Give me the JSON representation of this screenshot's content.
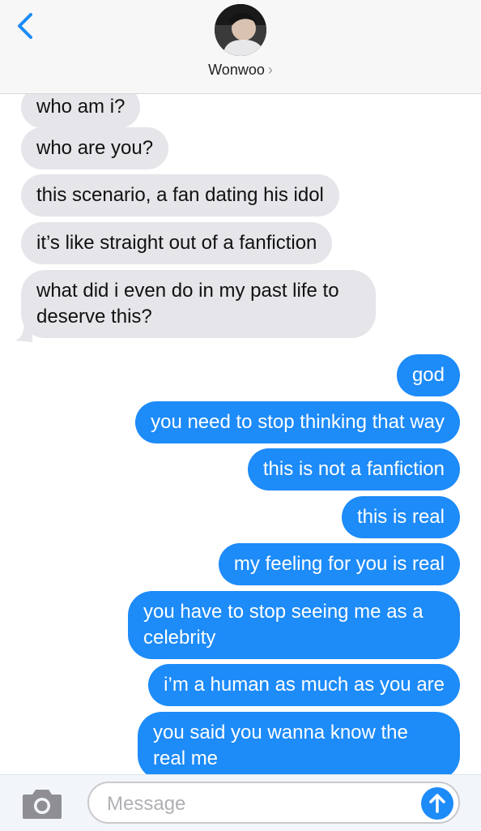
{
  "header": {
    "contact_name": "Wonwoo",
    "contact_chevron": "›",
    "back_icon": "chevron-left-icon",
    "accent_color": "#1d8bf8"
  },
  "messages": [
    {
      "from": "contact",
      "text": "who am i?"
    },
    {
      "from": "contact",
      "text": "who are you?"
    },
    {
      "from": "contact",
      "text": "this scenario, a fan dating his idol"
    },
    {
      "from": "contact",
      "text": "it’s like straight out of a fanfiction"
    },
    {
      "from": "contact",
      "text": "what did i even do in my past life to deserve this?"
    },
    {
      "from": "me",
      "text": "god"
    },
    {
      "from": "me",
      "text": "you need to stop thinking that way"
    },
    {
      "from": "me",
      "text": "this is not a fanfiction"
    },
    {
      "from": "me",
      "text": "this is real"
    },
    {
      "from": "me",
      "text": "my feeling for you is real"
    },
    {
      "from": "me",
      "text": "you have to stop seeing me as a celebrity"
    },
    {
      "from": "me",
      "text": "i’m a human as much as you are"
    },
    {
      "from": "me",
      "text": "you said you wanna know the real me"
    }
  ],
  "composer": {
    "placeholder": "Message",
    "camera_icon": "camera-icon",
    "send_icon": "send-arrow-icon"
  },
  "colors": {
    "incoming_bubble": "#e5e5ea",
    "outgoing_bubble": "#1d8bf8"
  }
}
